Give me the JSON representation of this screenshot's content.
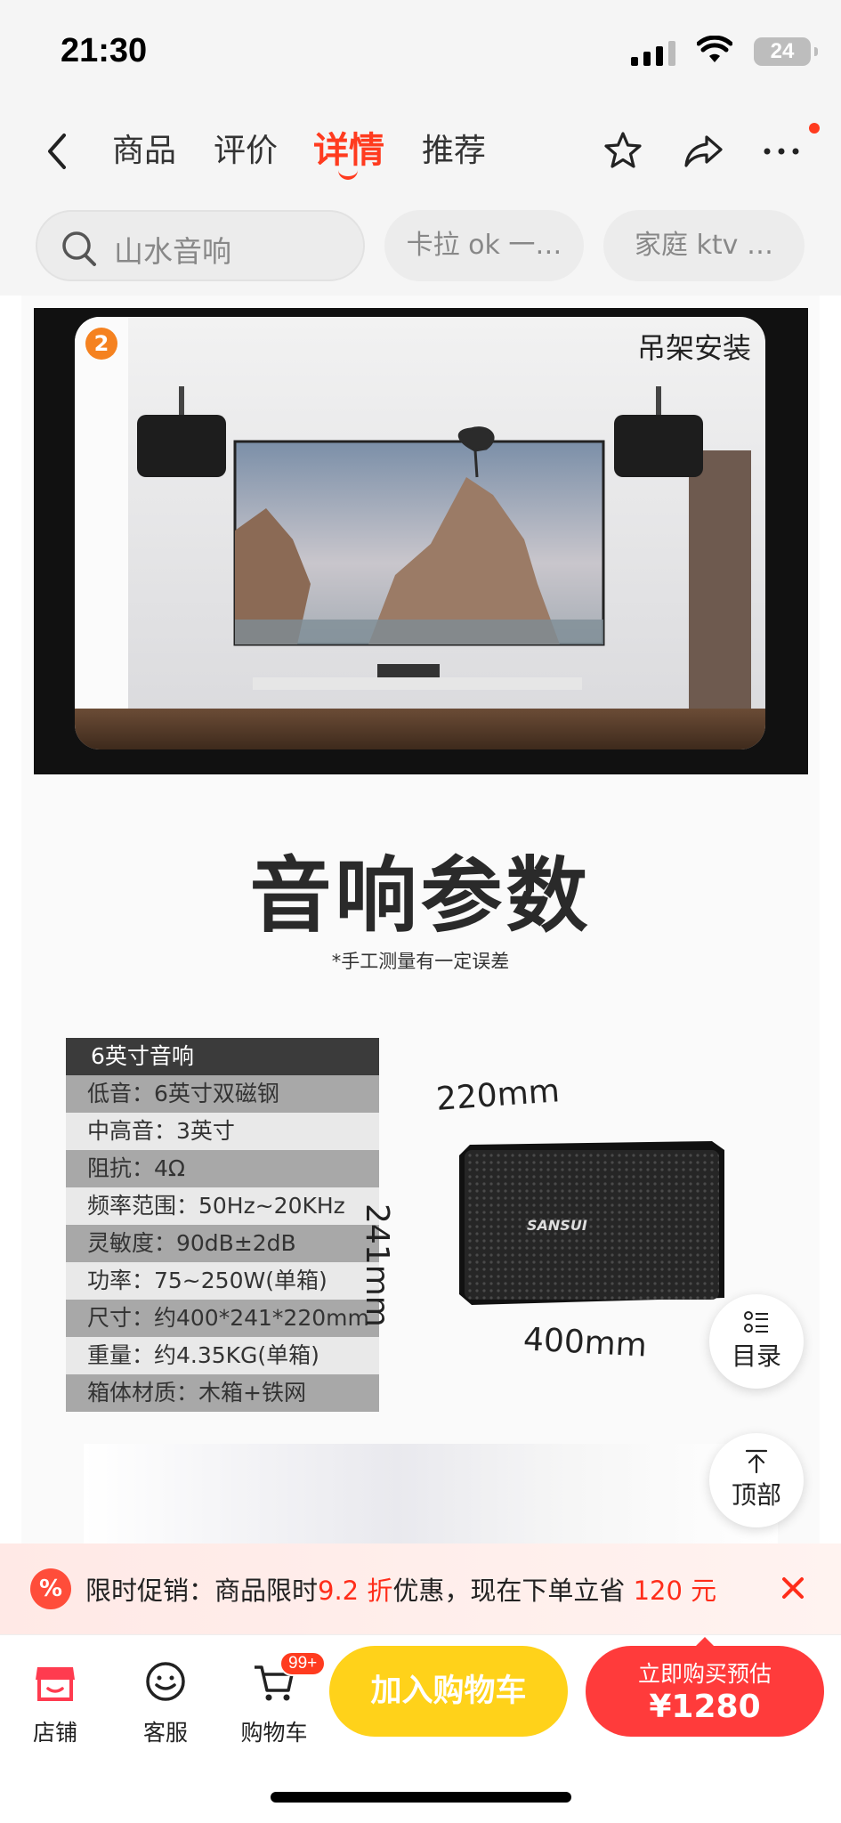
{
  "status_bar": {
    "time": "21:30",
    "battery": "24"
  },
  "nav": {
    "tabs": [
      "商品",
      "评价",
      "详情",
      "推荐"
    ],
    "active_tab": "详情"
  },
  "search": {
    "placeholder": "山水音响",
    "chips": [
      "卡拉 ok 一…",
      "家庭 ktv …"
    ]
  },
  "banner": {
    "number": "2",
    "label": "吊架安装"
  },
  "section": {
    "title": "音响参数",
    "note": "*手工测量有一定误差"
  },
  "spec_table": {
    "header": "6英寸音响",
    "rows": [
      "低音：6英寸双磁钢",
      "中高音：3英寸",
      "阻抗：4Ω",
      "频率范围：50Hz~20KHz",
      "灵敏度：90dB±2dB",
      "功率：75~250W(单箱)",
      "尺寸：约400*241*220mm",
      "重量：约4.35KG(单箱)",
      "箱体材质：木箱+铁网"
    ]
  },
  "dimensions": {
    "depth": "220mm",
    "height": "241mm",
    "width": "400mm",
    "brand": "SANSUI"
  },
  "floating": {
    "catalog": "目录",
    "top": "顶部"
  },
  "promo": {
    "prefix": "限时促销：商品限时",
    "discount": "9.2 折",
    "middle": "优惠，现在下单立省",
    "saving": "120 元"
  },
  "bottom_bar": {
    "shop": "店铺",
    "service": "客服",
    "cart": "购物车",
    "cart_badge": "99+",
    "add_to_cart": "加入购物车",
    "buy_now": "立即购买预估",
    "price": "¥1280"
  },
  "colors": {
    "accent": "#ff3b1f",
    "cart_button": "#ffd21a",
    "buy_button": "#ff3b3b"
  }
}
